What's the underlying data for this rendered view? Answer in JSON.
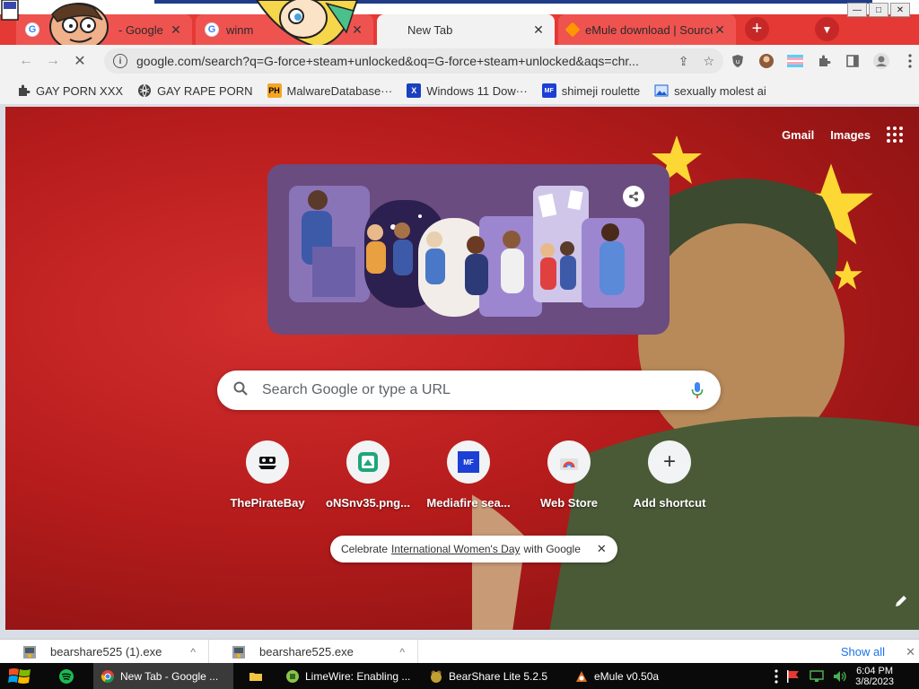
{
  "window": {
    "minimize": "—",
    "maximize": "□",
    "close": "✕"
  },
  "tabs": [
    {
      "title": "- Google",
      "close": "✕"
    },
    {
      "title": "winm",
      "close": "✕"
    },
    {
      "title": "New Tab",
      "close": "✕"
    },
    {
      "title": "eMule download | SourceForge",
      "close": "✕"
    }
  ],
  "tabstrip": {
    "new_tab": "+",
    "tab_search": "▼"
  },
  "toolbar": {
    "back": "←",
    "forward": "→",
    "reload": "✕",
    "url": "google.com/search?q=G-force+steam+unlocked&oq=G-force+steam+unlocked&aqs=chr...",
    "info": "i",
    "share": "⇪",
    "bookmark_star": "☆"
  },
  "bookmarks": [
    {
      "label": "GAY PORN XXX",
      "icon": "puzzle-icon"
    },
    {
      "label": "GAY RAPE PORN",
      "icon": "globe-icon"
    },
    {
      "label": "MalwareDatabase···",
      "icon": "ph-icon",
      "icon_text": "PH"
    },
    {
      "label": "Windows 11 Dow···",
      "icon": "x-icon",
      "icon_text": "X"
    },
    {
      "label": "shimeji roulette",
      "icon": "mf-icon",
      "icon_text": "MF"
    },
    {
      "label": "sexually molest ai",
      "icon": "image-icon"
    }
  ],
  "ntp": {
    "gmail": "Gmail",
    "images": "Images",
    "search_placeholder": "Search Google or type a URL",
    "shortcuts": [
      {
        "label": "ThePirateBay",
        "icon": "pirate-ship-icon"
      },
      {
        "label": "oNSnv35.png...",
        "icon": "image-file-icon"
      },
      {
        "label": "Mediafire sea...",
        "icon": "mediafire-icon",
        "icon_text": "MF"
      },
      {
        "label": "Web Store",
        "icon": "webstore-icon"
      },
      {
        "label": "Add shortcut",
        "icon": "plus-icon",
        "icon_text": "+"
      }
    ],
    "celebrate_pre": "Celebrate ",
    "celebrate_link": "International Women's Day",
    "celebrate_post": " with Google",
    "celebrate_close": "✕"
  },
  "downloads": {
    "items": [
      {
        "name": "bearshare525 (1).exe",
        "chev": "^"
      },
      {
        "name": "bearshare525.exe",
        "chev": "^"
      }
    ],
    "show_all": "Show all",
    "close": "✕"
  },
  "taskbar": {
    "apps": [
      {
        "label": "New Tab - Google ...",
        "color": "#4285f4",
        "active": true
      },
      {
        "label": "",
        "color": "#f4c542"
      },
      {
        "label": "LimeWire: Enabling ...",
        "color": "#8bc34a"
      },
      {
        "label": "BearShare Lite 5.2.5",
        "color": "#c0a030"
      },
      {
        "label": "eMule v0.50a",
        "color": "#e07020"
      }
    ],
    "time": "6:04 PM",
    "date": "3/8/2023"
  },
  "colors": {
    "tabstrip": "#e53935",
    "accent_link": "#1a73e8",
    "ntp_background": "#b71c1c"
  }
}
